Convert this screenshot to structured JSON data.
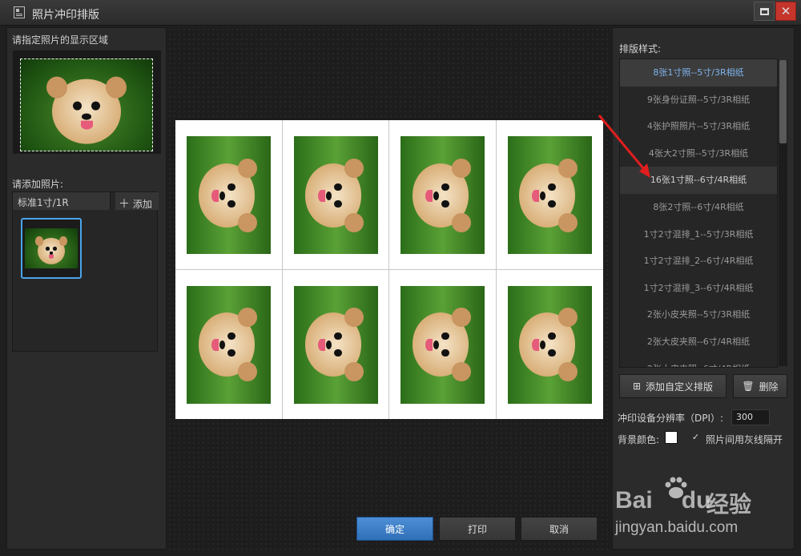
{
  "window": {
    "title": "照片冲印排版",
    "icon": "layout-icon"
  },
  "left_panel": {
    "display_area_label": "请指定照片的显示区域",
    "add_photo_label": "请添加照片:",
    "tab_label": "标准1寸/1R",
    "add_button_label": "添加",
    "add_icon": "plus-icon"
  },
  "right_panel": {
    "layout_style_label": "排版样式:",
    "layout_items": [
      "8张1寸照--5寸/3R相纸",
      "9张身份证照--5寸/3R相纸",
      "4张护照照片--5寸/3R相纸",
      "4张大2寸照--5寸/3R相纸",
      "16张1寸照--6寸/4R相纸",
      "8张2寸照--6寸/4R相纸",
      "1寸2寸混排_1--5寸/3R相纸",
      "1寸2寸混排_2--6寸/4R相纸",
      "1寸2寸混排_3--6寸/4R相纸",
      "2张小皮夹照--5寸/3R相纸",
      "2张大皮夹照--6寸/4R相纸",
      "2张大皮夹照--6寸/4R相纸"
    ],
    "selected_index": 0,
    "hover_index": 4,
    "add_custom_label": "添加自定义排版",
    "delete_label": "删除",
    "dpi_label": "冲印设备分辨率（DPI）:",
    "dpi_value": "300",
    "bg_color_label": "背景颜色:",
    "bg_color": "#ffffff",
    "separator_label": "照片间用灰线隔开",
    "separator_checked": "✓"
  },
  "footer": {
    "ok_label": "确定",
    "print_label": "打印",
    "cancel_label": "取消"
  },
  "preview": {
    "rows": 2,
    "cols": 4
  },
  "watermark": {
    "brand": "Bai",
    "brand2": "du",
    "suffix": "经验",
    "url": "jingyan.baidu.com"
  },
  "colors": {
    "accent": "#3a7fd0",
    "arrow": "#e01e1e",
    "selected_text": "#7fb4ee"
  }
}
